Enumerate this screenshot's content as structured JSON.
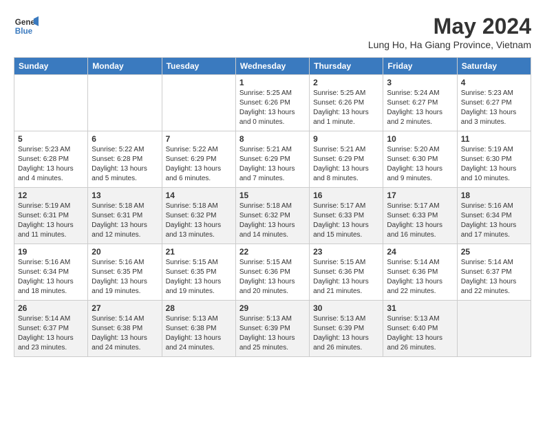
{
  "header": {
    "logo_line1": "General",
    "logo_line2": "Blue",
    "month_year": "May 2024",
    "location": "Lung Ho, Ha Giang Province, Vietnam"
  },
  "days_of_week": [
    "Sunday",
    "Monday",
    "Tuesday",
    "Wednesday",
    "Thursday",
    "Friday",
    "Saturday"
  ],
  "weeks": [
    [
      {
        "day": "",
        "detail": ""
      },
      {
        "day": "",
        "detail": ""
      },
      {
        "day": "",
        "detail": ""
      },
      {
        "day": "1",
        "detail": "Sunrise: 5:25 AM\nSunset: 6:26 PM\nDaylight: 13 hours\nand 0 minutes."
      },
      {
        "day": "2",
        "detail": "Sunrise: 5:25 AM\nSunset: 6:26 PM\nDaylight: 13 hours\nand 1 minute."
      },
      {
        "day": "3",
        "detail": "Sunrise: 5:24 AM\nSunset: 6:27 PM\nDaylight: 13 hours\nand 2 minutes."
      },
      {
        "day": "4",
        "detail": "Sunrise: 5:23 AM\nSunset: 6:27 PM\nDaylight: 13 hours\nand 3 minutes."
      }
    ],
    [
      {
        "day": "5",
        "detail": "Sunrise: 5:23 AM\nSunset: 6:28 PM\nDaylight: 13 hours\nand 4 minutes."
      },
      {
        "day": "6",
        "detail": "Sunrise: 5:22 AM\nSunset: 6:28 PM\nDaylight: 13 hours\nand 5 minutes."
      },
      {
        "day": "7",
        "detail": "Sunrise: 5:22 AM\nSunset: 6:29 PM\nDaylight: 13 hours\nand 6 minutes."
      },
      {
        "day": "8",
        "detail": "Sunrise: 5:21 AM\nSunset: 6:29 PM\nDaylight: 13 hours\nand 7 minutes."
      },
      {
        "day": "9",
        "detail": "Sunrise: 5:21 AM\nSunset: 6:29 PM\nDaylight: 13 hours\nand 8 minutes."
      },
      {
        "day": "10",
        "detail": "Sunrise: 5:20 AM\nSunset: 6:30 PM\nDaylight: 13 hours\nand 9 minutes."
      },
      {
        "day": "11",
        "detail": "Sunrise: 5:19 AM\nSunset: 6:30 PM\nDaylight: 13 hours\nand 10 minutes."
      }
    ],
    [
      {
        "day": "12",
        "detail": "Sunrise: 5:19 AM\nSunset: 6:31 PM\nDaylight: 13 hours\nand 11 minutes."
      },
      {
        "day": "13",
        "detail": "Sunrise: 5:18 AM\nSunset: 6:31 PM\nDaylight: 13 hours\nand 12 minutes."
      },
      {
        "day": "14",
        "detail": "Sunrise: 5:18 AM\nSunset: 6:32 PM\nDaylight: 13 hours\nand 13 minutes."
      },
      {
        "day": "15",
        "detail": "Sunrise: 5:18 AM\nSunset: 6:32 PM\nDaylight: 13 hours\nand 14 minutes."
      },
      {
        "day": "16",
        "detail": "Sunrise: 5:17 AM\nSunset: 6:33 PM\nDaylight: 13 hours\nand 15 minutes."
      },
      {
        "day": "17",
        "detail": "Sunrise: 5:17 AM\nSunset: 6:33 PM\nDaylight: 13 hours\nand 16 minutes."
      },
      {
        "day": "18",
        "detail": "Sunrise: 5:16 AM\nSunset: 6:34 PM\nDaylight: 13 hours\nand 17 minutes."
      }
    ],
    [
      {
        "day": "19",
        "detail": "Sunrise: 5:16 AM\nSunset: 6:34 PM\nDaylight: 13 hours\nand 18 minutes."
      },
      {
        "day": "20",
        "detail": "Sunrise: 5:16 AM\nSunset: 6:35 PM\nDaylight: 13 hours\nand 19 minutes."
      },
      {
        "day": "21",
        "detail": "Sunrise: 5:15 AM\nSunset: 6:35 PM\nDaylight: 13 hours\nand 19 minutes."
      },
      {
        "day": "22",
        "detail": "Sunrise: 5:15 AM\nSunset: 6:36 PM\nDaylight: 13 hours\nand 20 minutes."
      },
      {
        "day": "23",
        "detail": "Sunrise: 5:15 AM\nSunset: 6:36 PM\nDaylight: 13 hours\nand 21 minutes."
      },
      {
        "day": "24",
        "detail": "Sunrise: 5:14 AM\nSunset: 6:36 PM\nDaylight: 13 hours\nand 22 minutes."
      },
      {
        "day": "25",
        "detail": "Sunrise: 5:14 AM\nSunset: 6:37 PM\nDaylight: 13 hours\nand 22 minutes."
      }
    ],
    [
      {
        "day": "26",
        "detail": "Sunrise: 5:14 AM\nSunset: 6:37 PM\nDaylight: 13 hours\nand 23 minutes."
      },
      {
        "day": "27",
        "detail": "Sunrise: 5:14 AM\nSunset: 6:38 PM\nDaylight: 13 hours\nand 24 minutes."
      },
      {
        "day": "28",
        "detail": "Sunrise: 5:13 AM\nSunset: 6:38 PM\nDaylight: 13 hours\nand 24 minutes."
      },
      {
        "day": "29",
        "detail": "Sunrise: 5:13 AM\nSunset: 6:39 PM\nDaylight: 13 hours\nand 25 minutes."
      },
      {
        "day": "30",
        "detail": "Sunrise: 5:13 AM\nSunset: 6:39 PM\nDaylight: 13 hours\nand 26 minutes."
      },
      {
        "day": "31",
        "detail": "Sunrise: 5:13 AM\nSunset: 6:40 PM\nDaylight: 13 hours\nand 26 minutes."
      },
      {
        "day": "",
        "detail": ""
      }
    ]
  ]
}
